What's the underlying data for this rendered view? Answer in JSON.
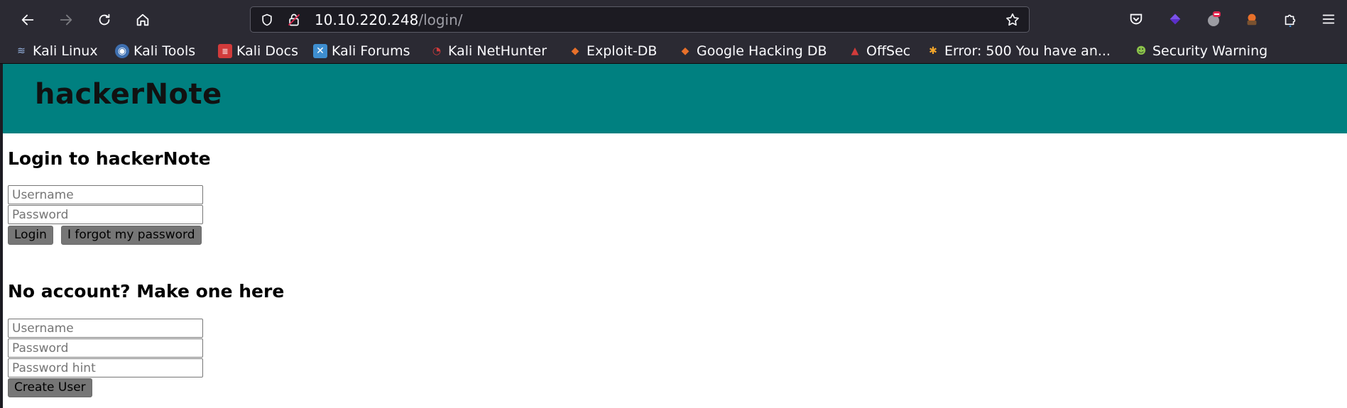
{
  "browser": {
    "url_host": "10.10.220.248",
    "url_path": "/login/",
    "bookmarks": [
      {
        "label": "Kali Linux",
        "icon": "kali-icon",
        "color": "#3e6fb0"
      },
      {
        "label": "Kali Tools",
        "icon": "kali-tools-icon",
        "color": "#d13b3b"
      },
      {
        "label": "Kali Docs",
        "icon": "kali-docs-icon",
        "color": "#d13b3b"
      },
      {
        "label": "Kali Forums",
        "icon": "kali-forums-icon",
        "color": "#3e8ed0"
      },
      {
        "label": "Kali NetHunter",
        "icon": "nethunter-icon",
        "color": "#d13b3b"
      },
      {
        "label": "Exploit-DB",
        "icon": "exploit-db-icon",
        "color": "#e8702a"
      },
      {
        "label": "Google Hacking DB",
        "icon": "ghdb-icon",
        "color": "#e8702a"
      },
      {
        "label": "OffSec",
        "icon": "offsec-icon",
        "color": "#d13b3b"
      },
      {
        "label": "Error: 500 You have an...",
        "icon": "joomla-icon",
        "color": "#f4a62a"
      },
      {
        "label": "Security Warning",
        "icon": "warning-icon",
        "color": "#8bc34a"
      }
    ]
  },
  "site": {
    "title": "hackerNote",
    "header_color": "#008080"
  },
  "login": {
    "heading": "Login to hackerNote",
    "username_placeholder": "Username",
    "password_placeholder": "Password",
    "login_label": "Login",
    "forgot_label": "I forgot my password"
  },
  "register": {
    "heading": "No account? Make one here",
    "username_placeholder": "Username",
    "password_placeholder": "Password",
    "hint_placeholder": "Password hint",
    "create_label": "Create User"
  }
}
